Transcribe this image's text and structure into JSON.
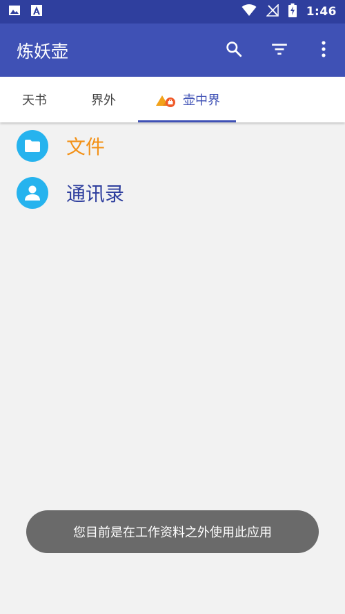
{
  "status_bar": {
    "time": "1:46",
    "icons": [
      "image-notification-icon",
      "text-notification-icon",
      "wifi-icon",
      "no-signal-icon",
      "battery-charging-icon"
    ]
  },
  "app_bar": {
    "title": "炼妖壶",
    "actions": [
      "search-icon",
      "filter-icon",
      "more-vert-icon"
    ],
    "color": "#3f51b5"
  },
  "tabs": [
    {
      "label": "天书",
      "selected": false
    },
    {
      "label": "界外",
      "selected": false
    },
    {
      "label": "壶中界",
      "selected": true,
      "icon": "work-profile-badge-icon"
    }
  ],
  "list": [
    {
      "label": "文件",
      "icon": "folder-icon",
      "color": "#f39117"
    },
    {
      "label": "通讯录",
      "icon": "person-icon",
      "color": "#2f3f9e"
    }
  ],
  "toast": {
    "text": "您目前是在工作资料之外使用此应用"
  }
}
